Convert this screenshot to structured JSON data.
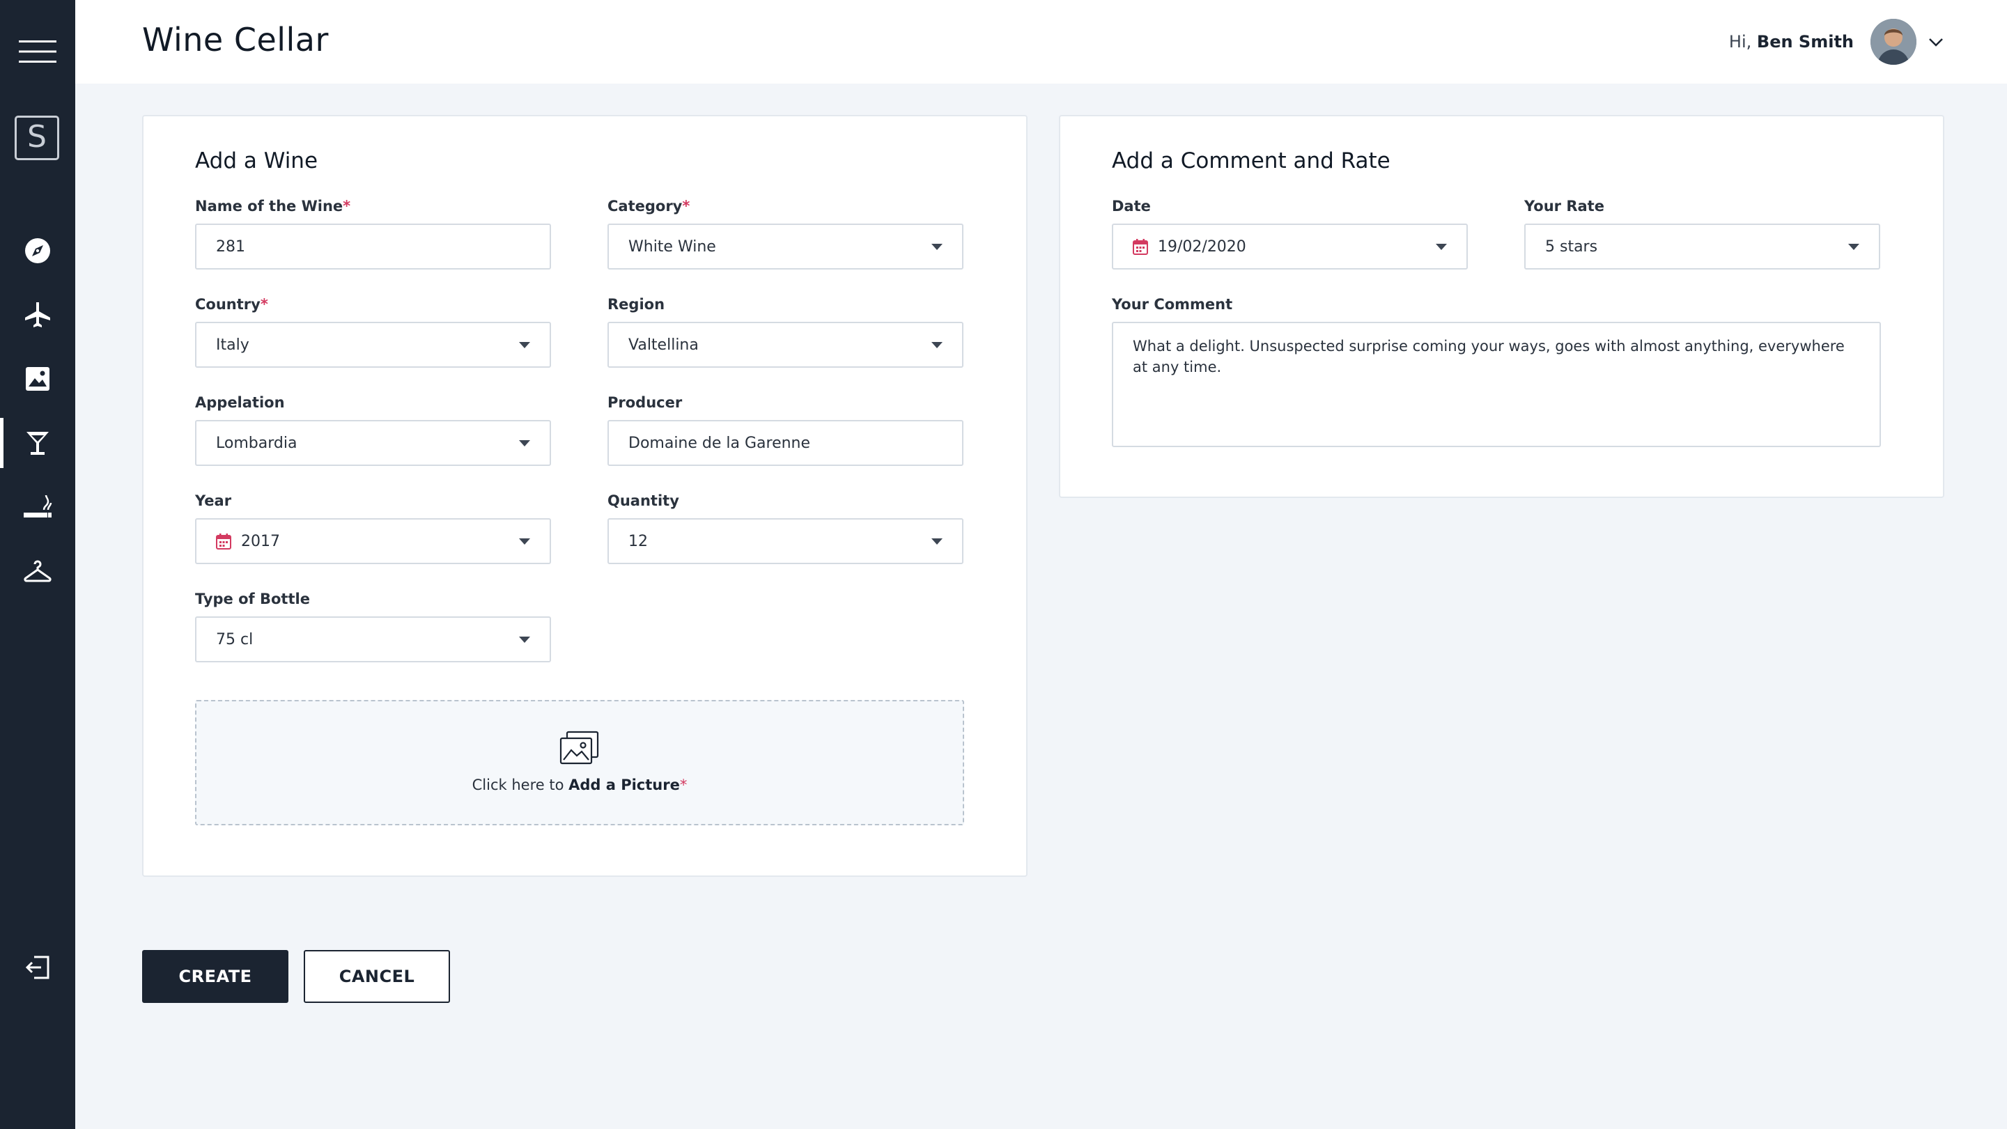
{
  "app": {
    "title": "Wine Cellar",
    "logo_letter": "S"
  },
  "sidebar": {
    "items": [
      {
        "icon": "menu-icon",
        "label": "Menu"
      },
      {
        "icon": "compass-icon",
        "label": "Explore"
      },
      {
        "icon": "airplane-icon",
        "label": "Travel"
      },
      {
        "icon": "image-icon",
        "label": "Pictures"
      },
      {
        "icon": "cocktail-glass-icon",
        "label": "Wine Cellar",
        "active": true
      },
      {
        "icon": "cigar-icon",
        "label": "Cigars"
      },
      {
        "icon": "hanger-icon",
        "label": "Wardrobe"
      },
      {
        "icon": "logout-icon",
        "label": "Log out"
      }
    ]
  },
  "header": {
    "greeting": "Hi,",
    "user_name": "Ben Smith"
  },
  "add_wine": {
    "title": "Add a Wine",
    "required_mark": "*",
    "name": {
      "label": "Name of the Wine",
      "value": "281"
    },
    "category": {
      "label": "Category",
      "value": "White Wine"
    },
    "country": {
      "label": "Country",
      "value": "Italy"
    },
    "region": {
      "label": "Region",
      "value": "Valtellina"
    },
    "appelation": {
      "label": "Appelation",
      "value": "Lombardia"
    },
    "producer": {
      "label": "Producer",
      "value": "Domaine de la Garenne"
    },
    "year": {
      "label": "Year",
      "value": "2017"
    },
    "quantity": {
      "label": "Quantity",
      "value": "12"
    },
    "bottle": {
      "label": "Type of Bottle",
      "value": "75 cl"
    },
    "upload": {
      "prefix": "Click here to",
      "action": "Add a Picture"
    }
  },
  "comment": {
    "title": "Add a Comment and Rate",
    "date": {
      "label": "Date",
      "value": "19/02/2020"
    },
    "rate": {
      "label": "Your Rate",
      "value": "5 stars"
    },
    "text": {
      "label": "Your Comment",
      "value": "What a delight. Unsuspected surprise coming your ways, goes with almost anything, everywhere at any time."
    }
  },
  "actions": {
    "create": "CREATE",
    "cancel": "CANCEL"
  },
  "colors": {
    "sidebar": "#1b2431",
    "accent_required": "#d33a60",
    "background": "#f2f5f9"
  }
}
